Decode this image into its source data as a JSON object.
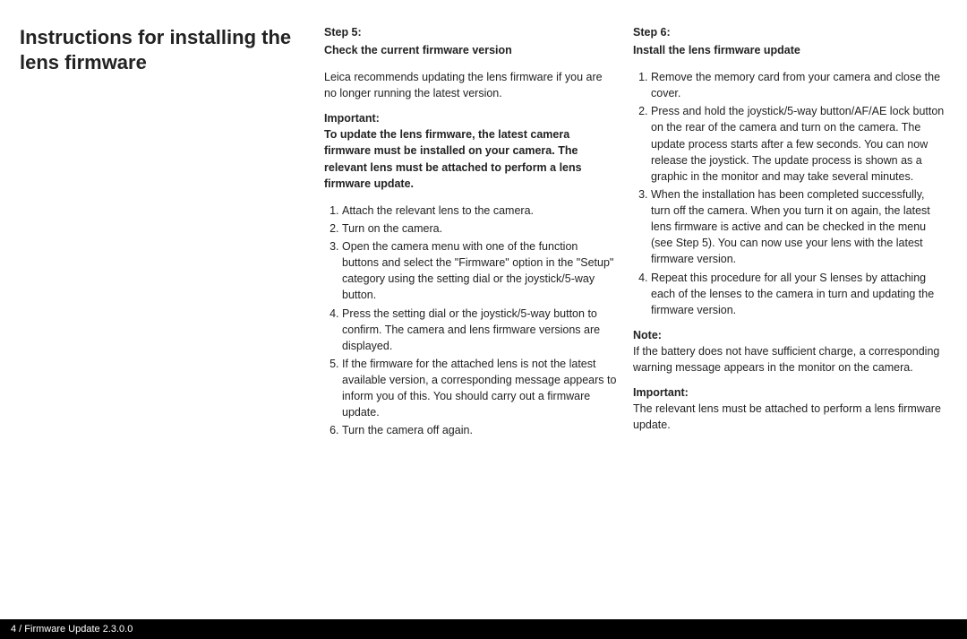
{
  "title": "Instructions for installing the lens firmware",
  "col2": {
    "step_label": "Step 5:",
    "step_heading": "Check the current firmware version",
    "intro": "Leica recommends updating the lens firmware if you are no longer running the latest version.",
    "important_label": "Important:",
    "important_text": "To update the lens firmware, the latest camera firmware must be installed on your camera. The relevant lens must be attached to perform a lens firmware update.",
    "steps": [
      "Attach the relevant lens to the camera.",
      "Turn on the camera.",
      "Open the camera menu with one of the function buttons and select the \"Firmware\" option in the \"Setup\" category using the setting dial or the joystick/5-way button.",
      "Press the setting dial or the joystick/5-way button to confirm. The camera and lens firmware versions are displayed.",
      "If the firmware for the attached lens is not the latest available version, a corresponding message appears to inform you of this. You should carry out a firmware update.",
      "Turn the camera off again."
    ]
  },
  "col3": {
    "step_label": "Step 6:",
    "step_heading": "Install the lens firmware update",
    "steps": [
      "Remove the memory card from your camera and close the cover.",
      "Press and hold the joystick/5-way button/AF/AE lock button on the rear of the camera and turn on the camera. The update process starts after a few seconds. You can now release the joystick. The update process is shown as a graphic in the monitor and may take several minutes.",
      "When the installation has been completed successfully, turn off the camera. When you turn it on again, the latest lens firmware is active and can be checked in the menu (see Step 5). You can now use your lens with the latest firmware version.",
      "Repeat this procedure for all your S lenses by attaching each of the lenses to the camera in turn and updating the firmware version."
    ],
    "note_label": "Note:",
    "note_text": "If the battery does not have sufficient charge, a corresponding warning message appears in the monitor on the camera.",
    "important_label": "Important:",
    "important_text": "The relevant lens must be attached to perform a lens firmware update."
  },
  "footer": "4 / Firmware Update 2.3.0.0"
}
